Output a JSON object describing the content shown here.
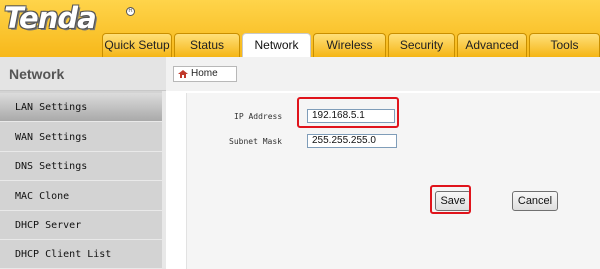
{
  "app": {
    "logo_text": "Tenda",
    "logo_mark": "R"
  },
  "tabs": [
    {
      "label": "Quick Setup",
      "active": false
    },
    {
      "label": "Status",
      "active": false
    },
    {
      "label": "Network",
      "active": true
    },
    {
      "label": "Wireless",
      "active": false
    },
    {
      "label": "Security",
      "active": false
    },
    {
      "label": "Advanced",
      "active": false
    },
    {
      "label": "Tools",
      "active": false
    }
  ],
  "sidebar": {
    "title": "Network",
    "items": [
      {
        "label": "LAN Settings",
        "active": true
      },
      {
        "label": "WAN Settings",
        "active": false
      },
      {
        "label": "DNS Settings",
        "active": false
      },
      {
        "label": "MAC Clone",
        "active": false
      },
      {
        "label": "DHCP Server",
        "active": false
      },
      {
        "label": "DHCP Client List",
        "active": false
      }
    ]
  },
  "breadcrumb": {
    "home_label": "Home",
    "home_icon": "home-icon"
  },
  "form": {
    "ip_address": {
      "label": "IP Address",
      "value": "192.168.5.1"
    },
    "subnet_mask": {
      "label": "Subnet Mask",
      "value": "255.255.255.0"
    },
    "save_label": "Save",
    "cancel_label": "Cancel"
  },
  "colors": {
    "header_yellow": "#f7b81a",
    "highlight_red": "#e0141c",
    "sidebar_gray": "#d3d3d3"
  }
}
